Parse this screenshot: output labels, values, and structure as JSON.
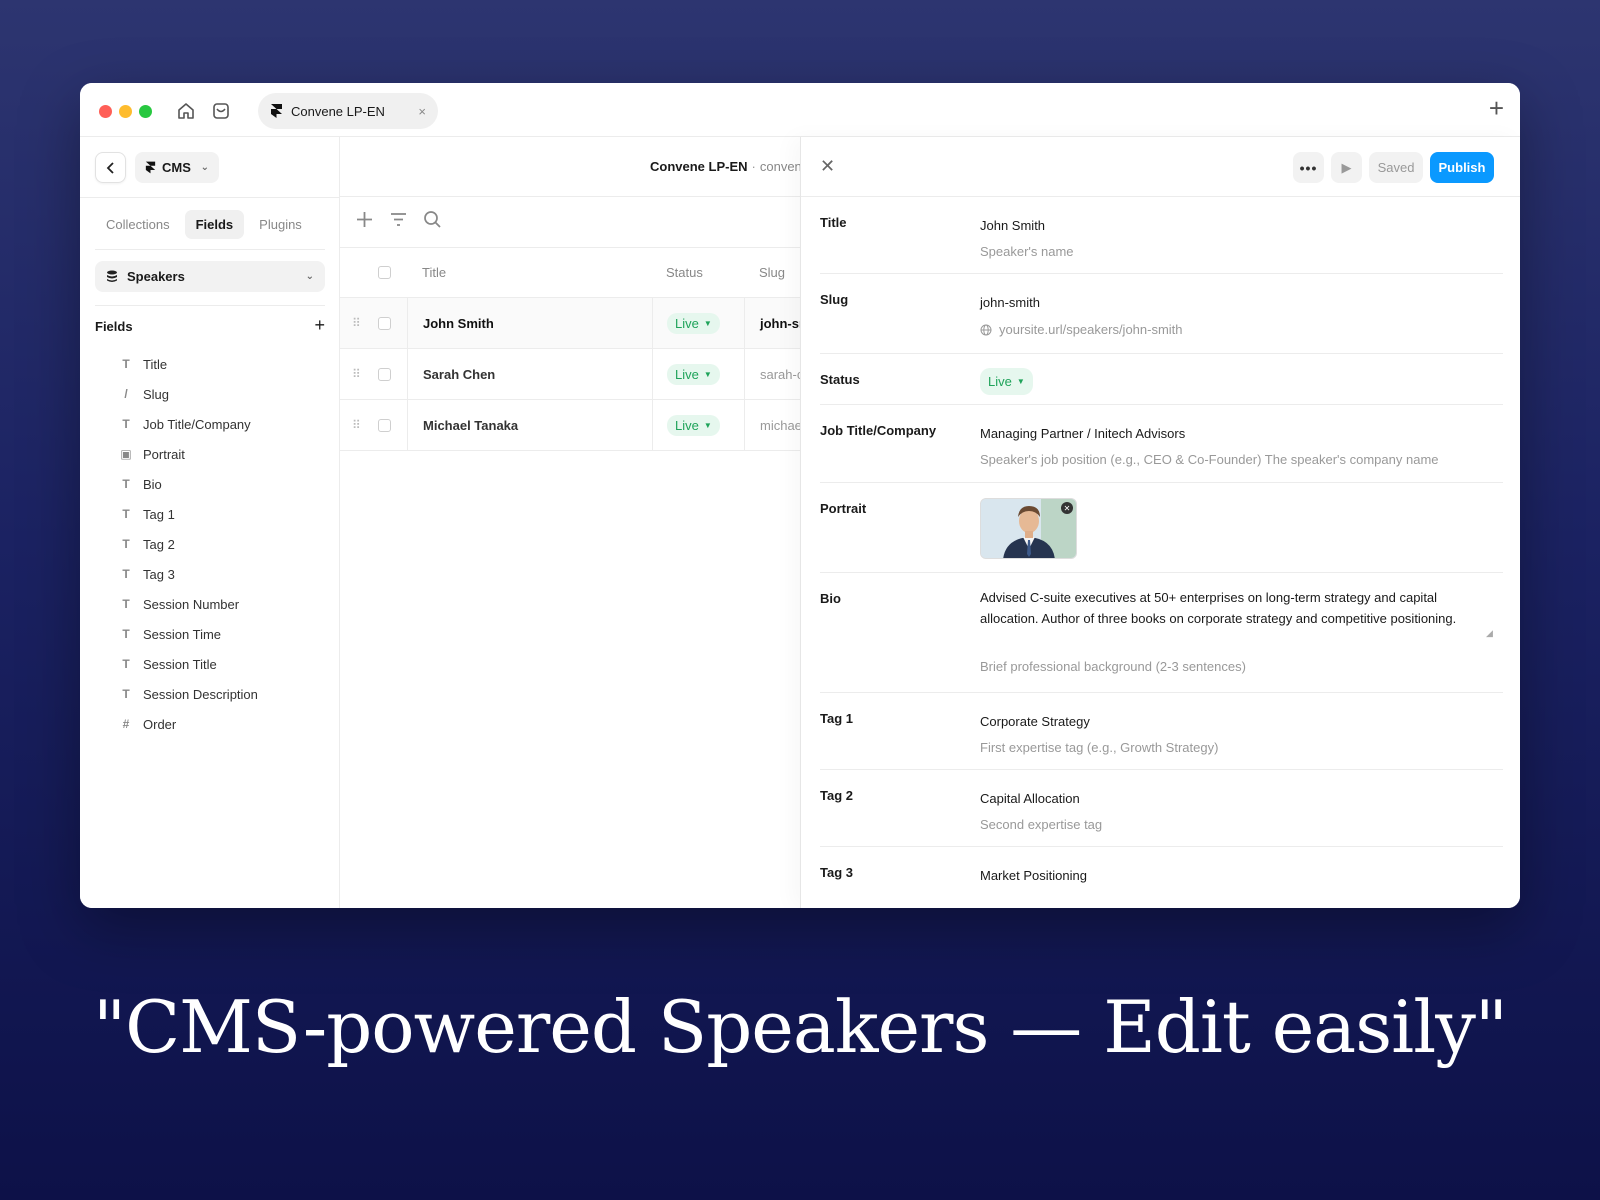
{
  "browser": {
    "tab_title": "Convene LP-EN",
    "tab_close": "×",
    "new_tab": "+"
  },
  "sidebar": {
    "cms_label": "CMS",
    "segments": [
      "Collections",
      "Fields",
      "Plugins"
    ],
    "active_segment": "Fields",
    "collection": "Speakers",
    "fields_heading": "Fields",
    "fields_add": "+",
    "fields": [
      {
        "icon": "text-icon",
        "glyph": "T",
        "label": "Title"
      },
      {
        "icon": "slug-icon",
        "glyph": "/",
        "label": "Slug"
      },
      {
        "icon": "text-icon",
        "glyph": "T",
        "label": "Job Title/Company"
      },
      {
        "icon": "image-icon",
        "glyph": "▣",
        "label": "Portrait"
      },
      {
        "icon": "text-icon",
        "glyph": "T",
        "label": "Bio"
      },
      {
        "icon": "text-icon",
        "glyph": "T",
        "label": "Tag 1"
      },
      {
        "icon": "text-icon",
        "glyph": "T",
        "label": "Tag 2"
      },
      {
        "icon": "text-icon",
        "glyph": "T",
        "label": "Tag 3"
      },
      {
        "icon": "text-icon",
        "glyph": "T",
        "label": "Session Number"
      },
      {
        "icon": "text-icon",
        "glyph": "T",
        "label": "Session Time"
      },
      {
        "icon": "text-icon",
        "glyph": "T",
        "label": "Session Title"
      },
      {
        "icon": "text-icon",
        "glyph": "T",
        "label": "Session Description"
      },
      {
        "icon": "number-icon",
        "glyph": "#",
        "label": "Order"
      }
    ]
  },
  "breadcrumb": {
    "project": "Convene LP-EN",
    "separator": "·",
    "domain": "convene"
  },
  "table": {
    "columns": [
      "Title",
      "Status",
      "Slug"
    ],
    "rows": [
      {
        "title": "John Smith",
        "status": "Live",
        "slug": "john-smith"
      },
      {
        "title": "Sarah Chen",
        "status": "Live",
        "slug": "sarah-chen"
      },
      {
        "title": "Michael Tanaka",
        "status": "Live",
        "slug": "michael-tanaka"
      }
    ]
  },
  "detail": {
    "more_label": "•••",
    "saved_label": "Saved",
    "publish_label": "Publish",
    "fields": {
      "title": {
        "label": "Title",
        "value": "John Smith",
        "hint": "Speaker's name"
      },
      "slug": {
        "label": "Slug",
        "value": "john-smith",
        "hint": "yoursite.url/speakers/john-smith"
      },
      "status": {
        "label": "Status",
        "value": "Live"
      },
      "job": {
        "label": "Job Title/Company",
        "value": "Managing Partner / Initech Advisors",
        "hint": "Speaker's job position (e.g., CEO & Co-Founder) The speaker's company name"
      },
      "portrait": {
        "label": "Portrait"
      },
      "bio": {
        "label": "Bio",
        "value": "Advised C-suite executives at 50+ enterprises on long-term strategy and capital allocation. Author of three books on corporate strategy and competitive positioning.",
        "hint": "Brief professional background (2-3 sentences)"
      },
      "tag1": {
        "label": "Tag 1",
        "value": "Corporate Strategy",
        "hint": "First expertise tag (e.g., Growth Strategy)"
      },
      "tag2": {
        "label": "Tag 2",
        "value": "Capital Allocation",
        "hint": "Second expertise tag"
      },
      "tag3": {
        "label": "Tag 3",
        "value": "Market Positioning"
      }
    }
  },
  "colors": {
    "accent": "#0a99ff",
    "live_text": "#1fa35a",
    "live_bg": "#e6f7ee",
    "background_top": "#2d3570",
    "background_bottom": "#0d1148"
  },
  "headline": "\"CMS-powered Speakers — Edit easily\""
}
